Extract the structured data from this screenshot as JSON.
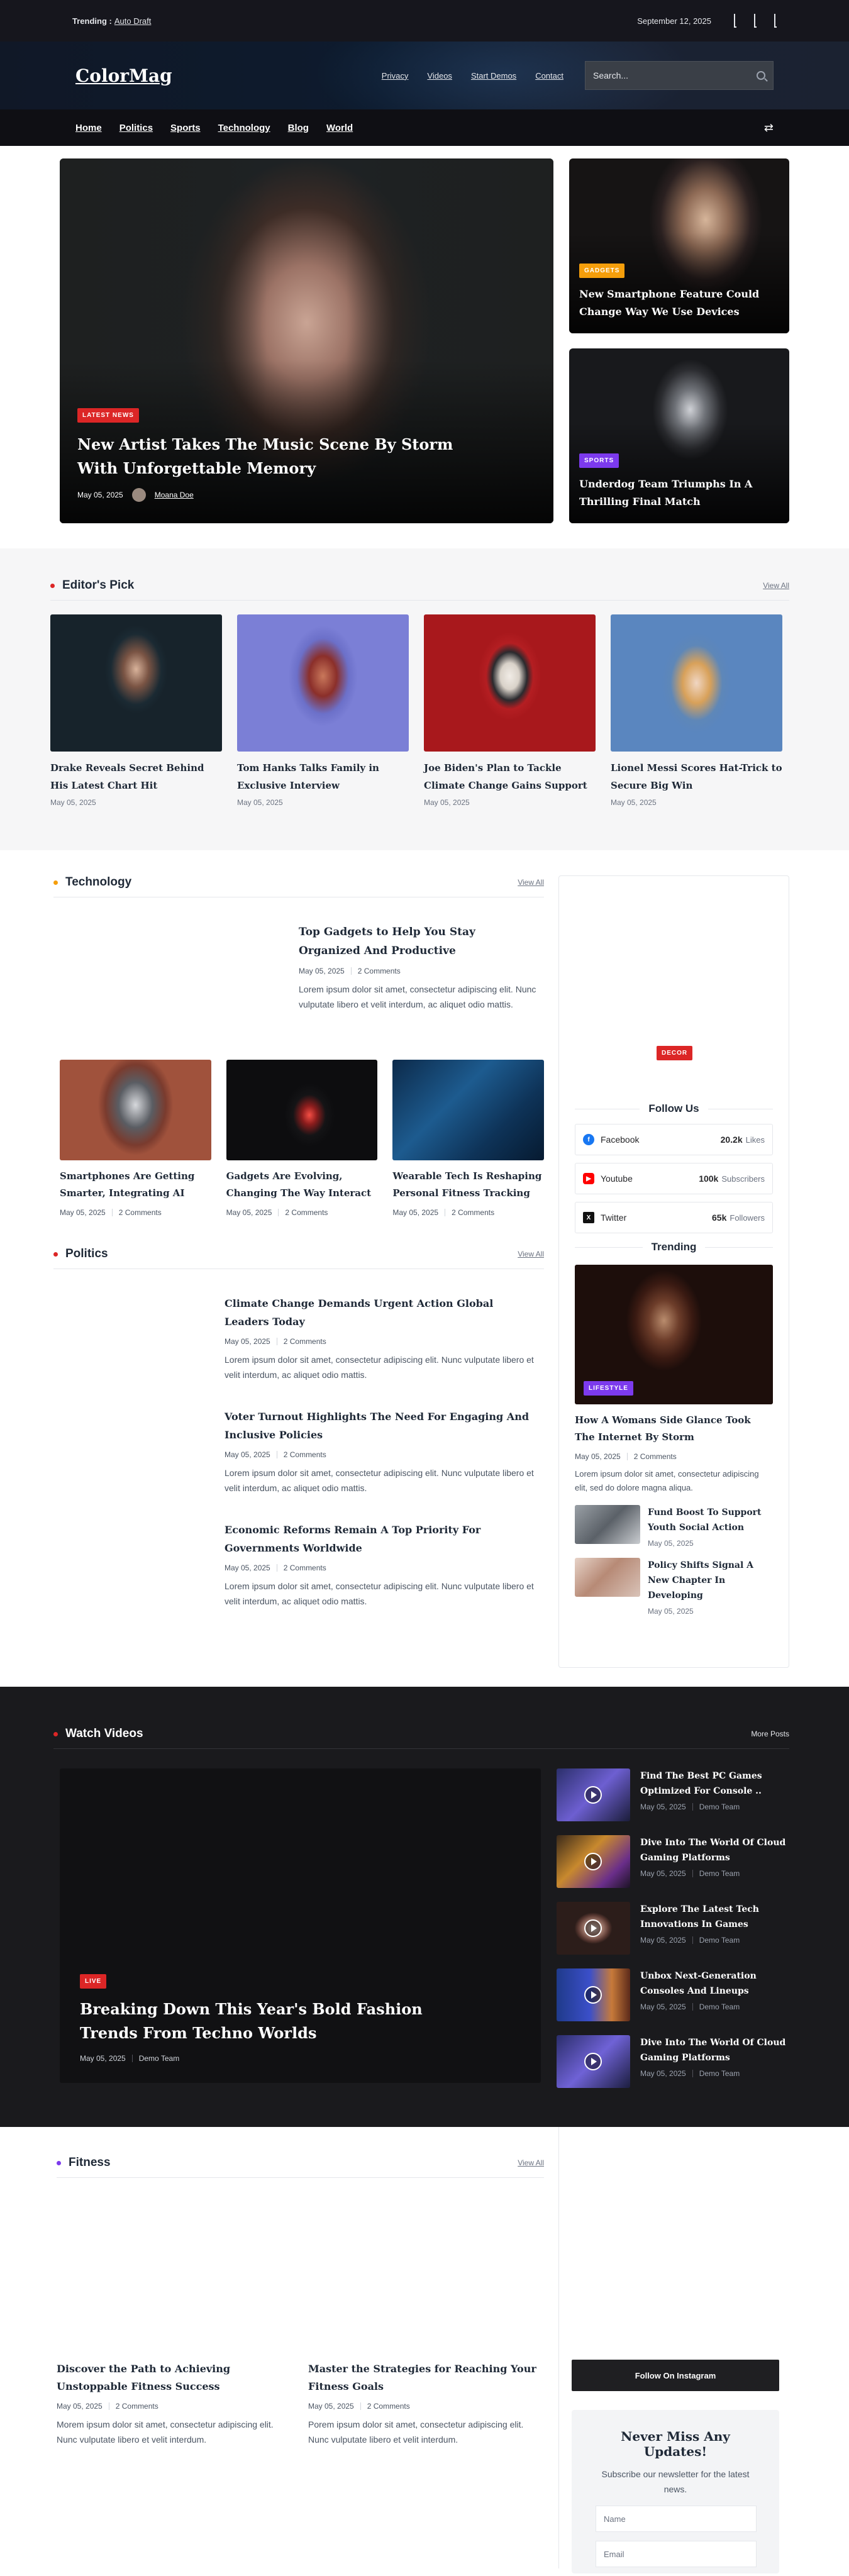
{
  "topbar": {
    "trending_label": "Trending :",
    "trending_link": "Auto Draft",
    "date": "September 12, 2025"
  },
  "header": {
    "logo": "ColorMag",
    "links": [
      "Privacy",
      "Videos",
      "Start Demos",
      "Contact"
    ],
    "search_placeholder": "Search..."
  },
  "nav": {
    "items": [
      "Home",
      "Politics",
      "Sports",
      "Technology",
      "Blog",
      "World"
    ]
  },
  "hero": {
    "main": {
      "badge": "LATEST NEWS",
      "title": "New Artist Takes The Music Scene By Storm With Unforgettable Memory",
      "date": "May 05, 2025",
      "author": "Moana Doe"
    },
    "side": [
      {
        "badge": "GADGETS",
        "title": "New Smartphone Feature Could Change Way We Use Devices"
      },
      {
        "badge": "SPORTS",
        "title": "Underdog Team Triumphs In A Thrilling Final Match"
      }
    ]
  },
  "editors_pick": {
    "title": "Editor's Pick",
    "view_all": "View All",
    "items": [
      {
        "title": "Drake Reveals Secret Behind His Latest Chart Hit",
        "date": "May 05, 2025"
      },
      {
        "title": "Tom Hanks Talks Family in Exclusive Interview",
        "date": "May 05, 2025"
      },
      {
        "title": "Joe Biden's Plan to Tackle Climate Change Gains Support",
        "date": "May 05, 2025"
      },
      {
        "title": "Lionel Messi Scores Hat-Trick to Secure Big Win",
        "date": "May 05, 2025"
      }
    ]
  },
  "technology": {
    "title": "Technology",
    "view_all": "View All",
    "featured": {
      "title": "Top Gadgets to Help You Stay Organized And Productive",
      "date": "May 05, 2025",
      "comments": "2 Comments",
      "excerpt": "Lorem ipsum dolor sit amet, consectetur adipiscing elit. Nunc vulputate libero et velit interdum, ac aliquet odio mattis."
    },
    "cards": [
      {
        "title": "Smartphones Are Getting Smarter, Integrating AI",
        "date": "May 05, 2025",
        "comments": "2 Comments"
      },
      {
        "title": "Gadgets Are Evolving, Changing The Way Interact",
        "date": "May 05, 2025",
        "comments": "2 Comments"
      },
      {
        "title": "Wearable Tech Is Reshaping Personal Fitness Tracking",
        "date": "May 05, 2025",
        "comments": "2 Comments"
      }
    ]
  },
  "politics": {
    "title": "Politics",
    "view_all": "View All",
    "items": [
      {
        "title": "Climate Change Demands Urgent Action Global Leaders Today",
        "date": "May 05, 2025",
        "comments": "2 Comments",
        "excerpt": "Lorem ipsum dolor sit amet, consectetur adipiscing elit. Nunc vulputate libero et velit interdum, ac aliquet odio mattis."
      },
      {
        "title": "Voter Turnout Highlights The Need For Engaging And Inclusive Policies",
        "date": "May 05, 2025",
        "comments": "2 Comments",
        "excerpt": "Lorem ipsum dolor sit amet, consectetur adipiscing elit. Nunc vulputate libero et velit interdum, ac aliquet odio mattis."
      },
      {
        "title": "Economic Reforms Remain A Top Priority For Governments Worldwide",
        "date": "May 05, 2025",
        "comments": "2 Comments",
        "excerpt": "Lorem ipsum dolor sit amet, consectetur adipiscing elit. Nunc vulputate libero et velit interdum, ac aliquet odio mattis."
      }
    ]
  },
  "sidebar": {
    "ad_badge": "DECOR",
    "follow_title": "Follow Us",
    "socials": [
      {
        "name": "Facebook",
        "count": "20.2k",
        "unit": "Likes",
        "icon": "facebook-icon",
        "color": "#1877f2"
      },
      {
        "name": "Youtube",
        "count": "100k",
        "unit": "Subscribers",
        "icon": "youtube-icon",
        "color": "#ff0000"
      },
      {
        "name": "Twitter",
        "count": "65k",
        "unit": "Followers",
        "icon": "x-twitter-icon",
        "color": "#111111"
      }
    ],
    "trending_title": "Trending",
    "trending_feature": {
      "badge": "LIFESTYLE",
      "title": "How A Womans Side Glance Took The Internet By Storm",
      "date": "May 05, 2025",
      "comments": "2 Comments",
      "excerpt": "Lorem ipsum dolor sit amet, consectetur adipiscing elit, sed do dolore magna aliqua."
    },
    "trending_small": [
      {
        "title": "Fund Boost To Support Youth Social Action",
        "date": "May 05, 2025"
      },
      {
        "title": "Policy Shifts Signal A New Chapter In Developing",
        "date": "May 05, 2025"
      }
    ]
  },
  "videos": {
    "title": "Watch Videos",
    "more": "More Posts",
    "main": {
      "badge": "LIVE",
      "title": "Breaking Down This Year's Bold Fashion Trends From Techno Worlds",
      "date": "May 05, 2025",
      "author": "Demo Team"
    },
    "list": [
      {
        "title": "Find The Best PC Games Optimized For Console ..",
        "date": "May 05, 2025",
        "author": "Demo Team"
      },
      {
        "title": "Dive Into The World Of Cloud Gaming Platforms",
        "date": "May 05, 2025",
        "author": "Demo Team"
      },
      {
        "title": "Explore The Latest Tech Innovations In Games",
        "date": "May 05, 2025",
        "author": "Demo Team"
      },
      {
        "title": "Unbox Next-Generation Consoles And Lineups",
        "date": "May 05, 2025",
        "author": "Demo Team"
      },
      {
        "title": "Dive Into The World Of Cloud Gaming Platforms",
        "date": "May 05, 2025",
        "author": "Demo Team"
      }
    ]
  },
  "fitness": {
    "title": "Fitness",
    "view_all": "View All",
    "items": [
      {
        "title": "Discover the Path to Achieving Unstoppable Fitness Success",
        "date": "May 05, 2025",
        "comments": "2 Comments",
        "excerpt": "Morem ipsum dolor sit amet, consectetur adipiscing elit. Nunc vulputate libero et velit interdum."
      },
      {
        "title": "Master the Strategies for Reaching Your Fitness Goals",
        "date": "May 05, 2025",
        "comments": "2 Comments",
        "excerpt": "Porem ipsum dolor sit amet, consectetur adipiscing elit. Nunc vulputate libero et velit interdum."
      }
    ]
  },
  "instagram": {
    "button": "Follow On Instagram"
  },
  "newsletter": {
    "title": "Never Miss Any Updates!",
    "text": "Subscribe our newsletter for the latest news.",
    "name_placeholder": "Name",
    "email_placeholder": "Email"
  },
  "colors": {
    "accent_red": "#dc2626",
    "accent_orange": "#f59e0b",
    "accent_purple": "#7c3aed"
  }
}
